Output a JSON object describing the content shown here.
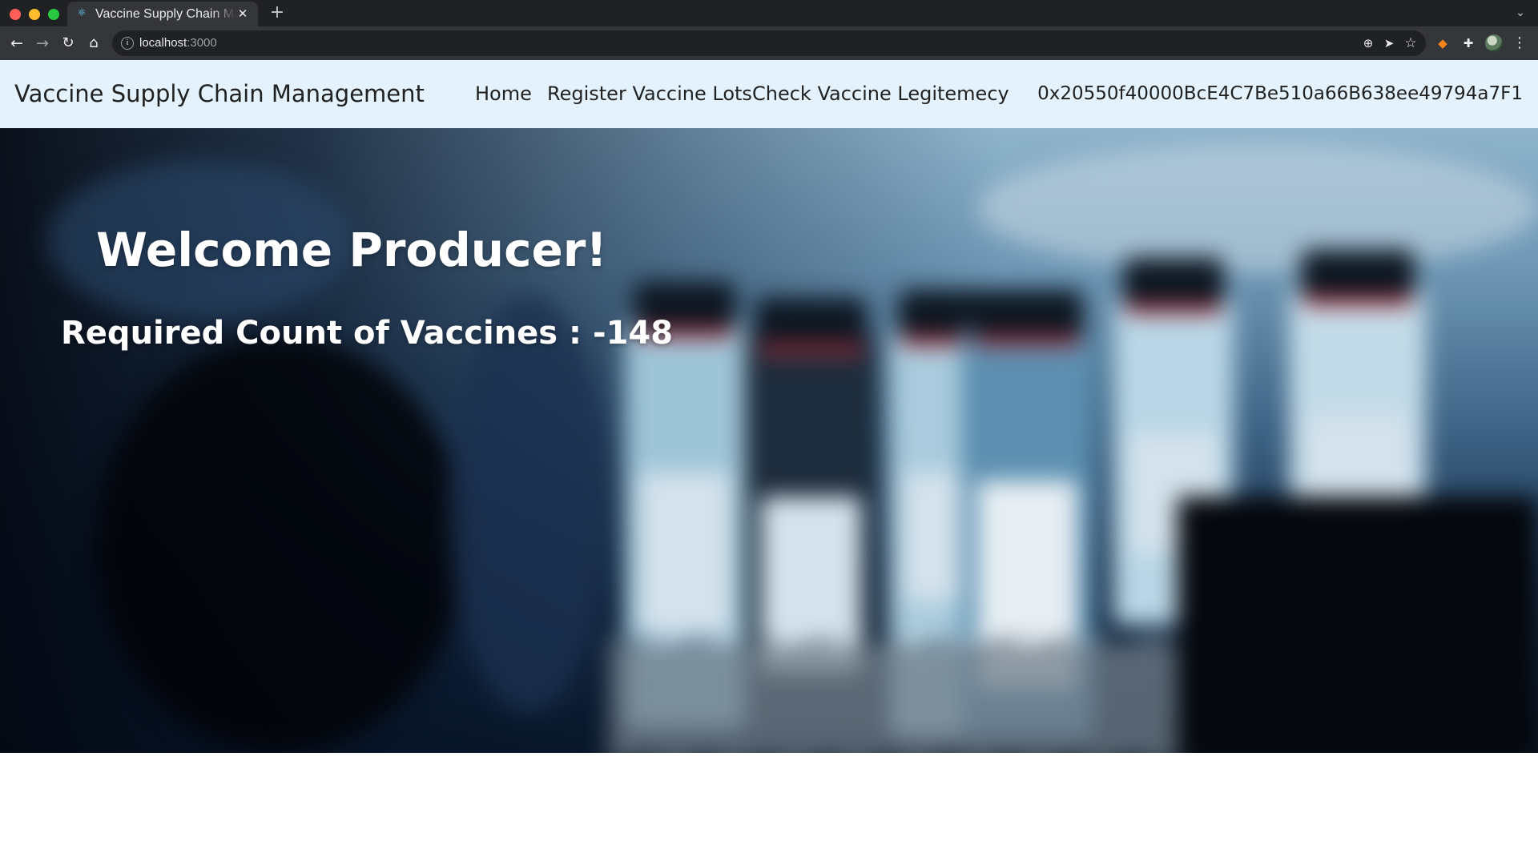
{
  "browser": {
    "tab_title": "Vaccine Supply Chain Management",
    "tab_favicon": "react-icon",
    "address": {
      "host": "localhost",
      "port": ":3000"
    }
  },
  "navbar": {
    "brand": "Vaccine Supply Chain Management",
    "links": [
      "Home",
      "Register Vaccine Lots",
      "Check Vaccine Legitemecy"
    ],
    "wallet_address": "0x20550f40000BcE4C7Be510a66B638ee49794a7F1"
  },
  "hero": {
    "title": "Welcome Producer!",
    "count_label": "Required Count of Vaccines : ",
    "count_value": "-148"
  },
  "colors": {
    "navbar_bg": "#e3f2fd",
    "browser_dark": "#202124",
    "browser_toolbar": "#35363a",
    "hero_text": "#ffffff"
  }
}
